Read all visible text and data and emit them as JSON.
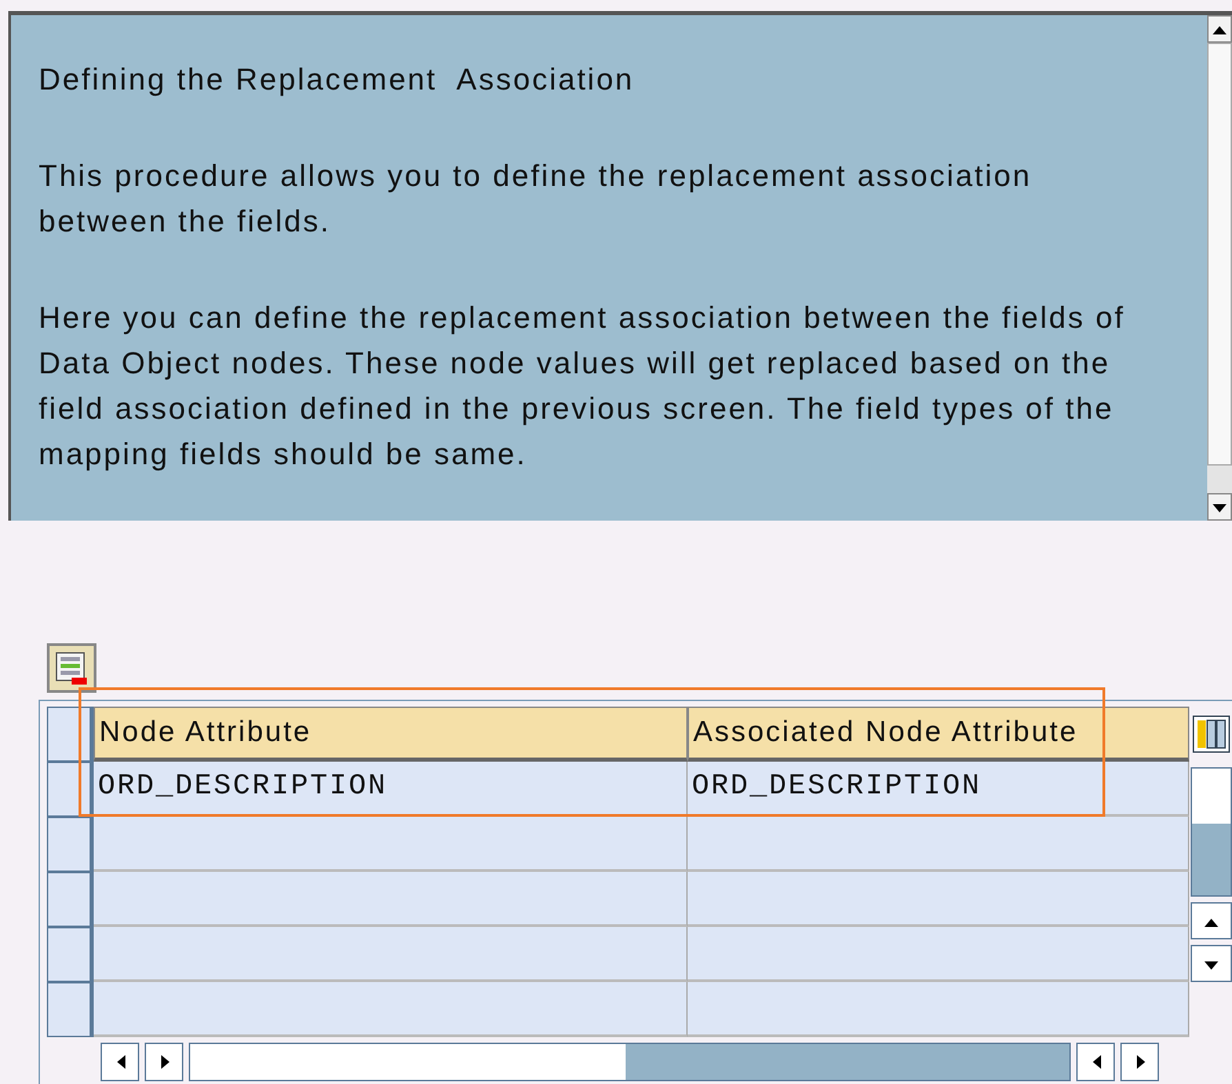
{
  "info_panel": {
    "title": "Defining the Replacement  Association",
    "paragraphs": [
      "This procedure allows you to define the replacement association between the fields.",
      "Here you can define the replacement association between the fields of Data Object nodes. These node values will get replaced based on the field association defined in the previous screen. The field types of the mapping fields should be same."
    ]
  },
  "table": {
    "columns": [
      "Node Attribute",
      "Associated Node Attribute"
    ],
    "rows": [
      {
        "cells": [
          "ORD_DESCRIPTION",
          "ORD_DESCRIPTION"
        ],
        "highlighted": true
      }
    ]
  }
}
